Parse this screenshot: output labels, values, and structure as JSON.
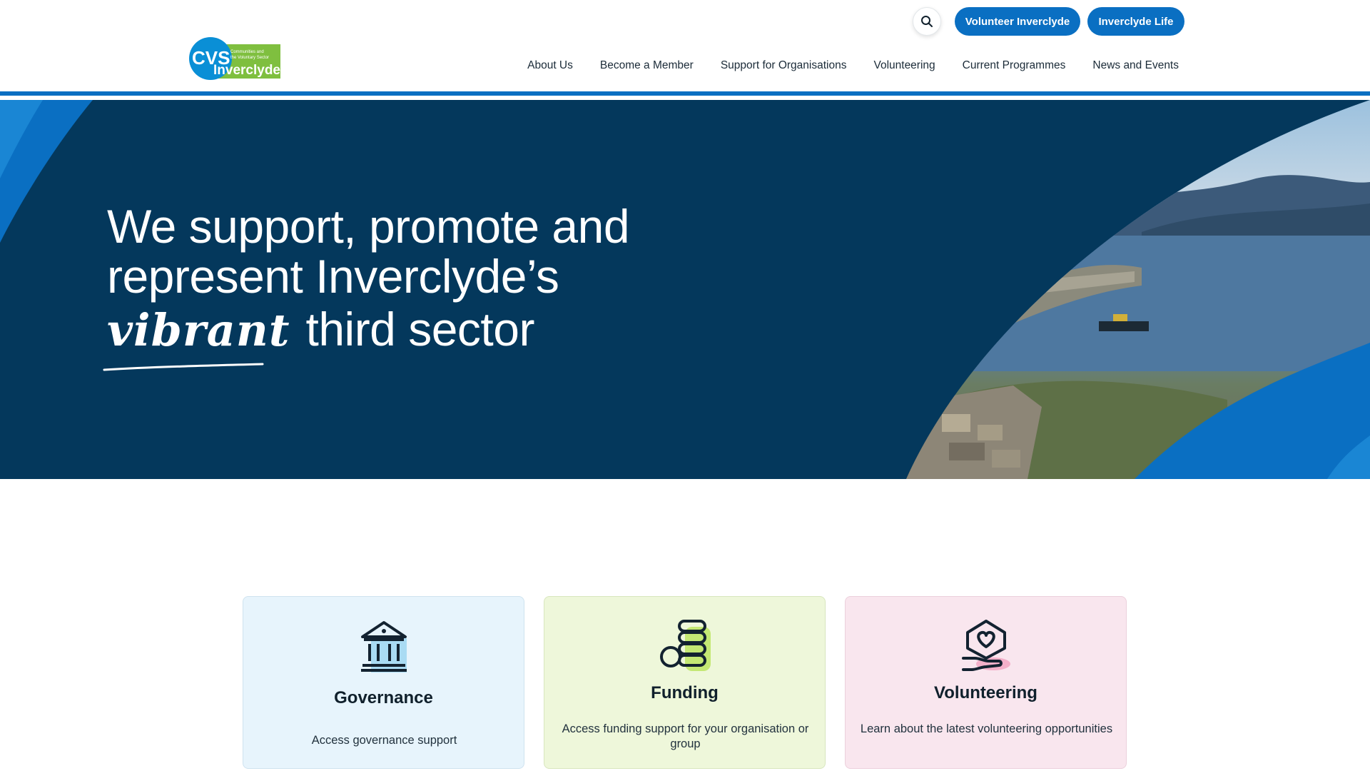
{
  "header": {
    "logo": {
      "primary": "CVS",
      "tagline_line1": "Communities and",
      "tagline_line2": "the Voluntary Sector",
      "name": "Inverclyde"
    },
    "search_icon": "search-icon",
    "buttons": {
      "volunteer": "Volunteer Inverclyde",
      "life": "Inverclyde Life"
    },
    "nav": [
      "About Us",
      "Become a Member",
      "Support for Organisations",
      "Volunteering",
      "Current Programmes",
      "News and Events"
    ]
  },
  "hero": {
    "line1": "We support, promote and",
    "line2": "represent Inverclyde’s",
    "highlight": "vibrant",
    "line3_rest": "third sector",
    "image": "inverclyde-coastline-photo"
  },
  "cards": [
    {
      "icon": "bank-building-icon",
      "title": "Governance",
      "desc": "Access governance support"
    },
    {
      "icon": "coins-stack-icon",
      "title": "Funding",
      "desc": "Access funding support for your organisation or group"
    },
    {
      "icon": "hand-heart-icon",
      "title": "Volunteering",
      "desc": "Learn about the latest volunteering opportunities"
    }
  ],
  "colors": {
    "brand_blue": "#0a6fc2",
    "hero_navy": "#04385c",
    "logo_green": "#7fbf3f",
    "governance_bg": "#e7f4fc",
    "funding_bg": "#eef7da",
    "volunteering_bg": "#f9e6ee"
  }
}
